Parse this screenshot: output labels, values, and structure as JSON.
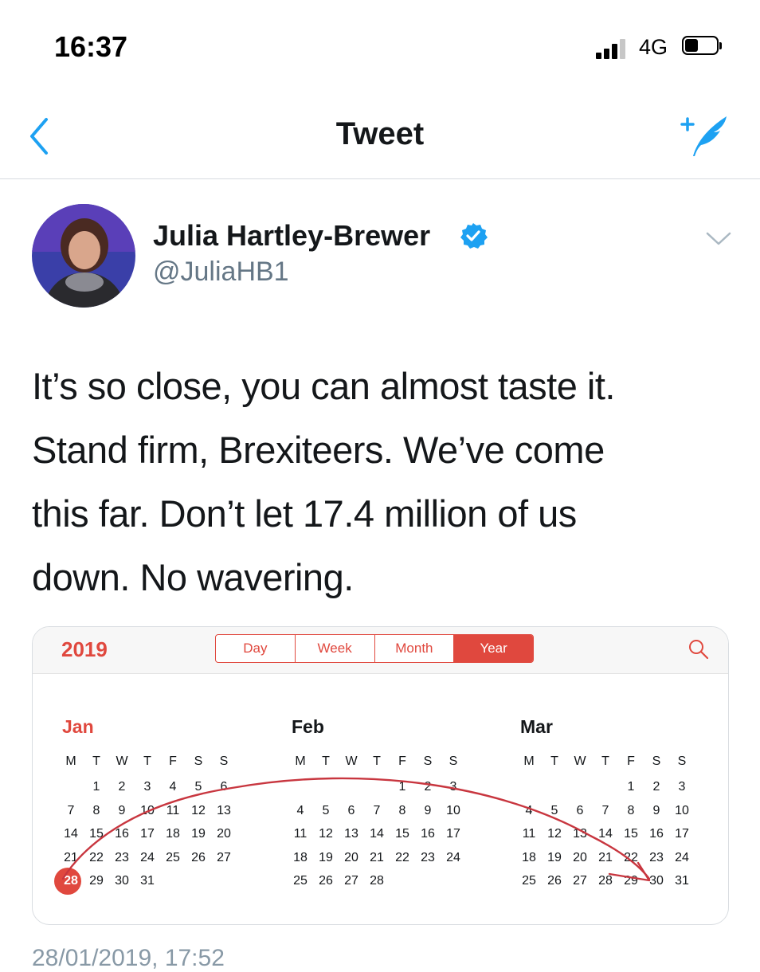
{
  "status_bar": {
    "time": "16:37",
    "network": "4G",
    "signal_icon": "signal-bars-icon",
    "battery_icon": "battery-icon"
  },
  "nav": {
    "title": "Tweet",
    "back_icon": "chevron-left-icon",
    "compose_icon": "compose-tweet-icon"
  },
  "tweet": {
    "user_name": "Julia Hartley-Brewer",
    "handle": "@JuliaHB1",
    "verified_icon": "verified-badge-icon",
    "text": "It’s so close, you can almost taste it.\nStand firm, Brexiteers. We’ve come\nthis far. Don’t let 17.4 million of us\ndown. No wavering.",
    "timestamp": "28/01/2019, 17:52"
  },
  "calendar": {
    "year": "2019",
    "views": [
      "Day",
      "Week",
      "Month",
      "Year"
    ],
    "active_view": "Year",
    "weekday_labels": [
      "M",
      "T",
      "W",
      "T",
      "F",
      "S",
      "S"
    ],
    "today": "28",
    "months": [
      {
        "name": "Jan",
        "is_current": true,
        "weeks": [
          [
            "",
            "1",
            "2",
            "3",
            "4",
            "5",
            "6"
          ],
          [
            "7",
            "8",
            "9",
            "10",
            "11",
            "12",
            "13"
          ],
          [
            "14",
            "15",
            "16",
            "17",
            "18",
            "19",
            "20"
          ],
          [
            "21",
            "22",
            "23",
            "24",
            "25",
            "26",
            "27"
          ],
          [
            "28",
            "29",
            "30",
            "31",
            "",
            "",
            ""
          ]
        ]
      },
      {
        "name": "Feb",
        "is_current": false,
        "weeks": [
          [
            "",
            "",
            "",
            "",
            "1",
            "2",
            "3"
          ],
          [
            "4",
            "5",
            "6",
            "7",
            "8",
            "9",
            "10"
          ],
          [
            "11",
            "12",
            "13",
            "14",
            "15",
            "16",
            "17"
          ],
          [
            "18",
            "19",
            "20",
            "21",
            "22",
            "23",
            "24"
          ],
          [
            "25",
            "26",
            "27",
            "28",
            "",
            "",
            ""
          ]
        ]
      },
      {
        "name": "Mar",
        "is_current": false,
        "weeks": [
          [
            "",
            "",
            "",
            "",
            "1",
            "2",
            "3"
          ],
          [
            "4",
            "5",
            "6",
            "7",
            "8",
            "9",
            "10"
          ],
          [
            "11",
            "12",
            "13",
            "14",
            "15",
            "16",
            "17"
          ],
          [
            "18",
            "19",
            "20",
            "21",
            "22",
            "23",
            "24"
          ],
          [
            "25",
            "26",
            "27",
            "28",
            "29",
            "30",
            "31"
          ]
        ]
      }
    ]
  },
  "colors": {
    "accent": "#e0483e",
    "link": "#1da1f2",
    "annotation": "#c8363f"
  }
}
